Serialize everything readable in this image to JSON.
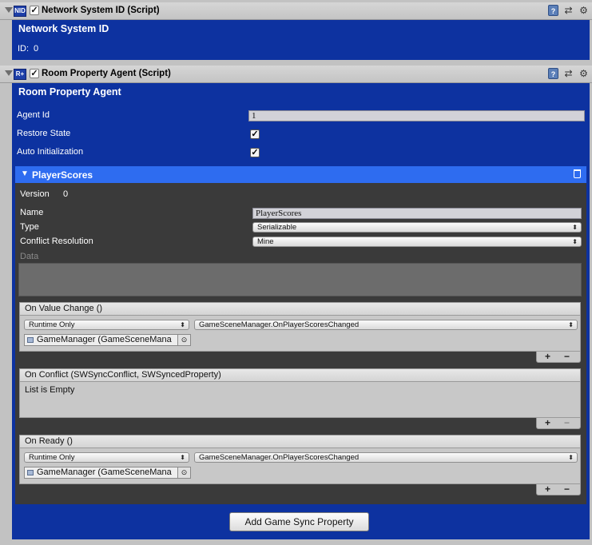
{
  "components": [
    {
      "title": "Network System ID (Script)",
      "icon_text": "NID",
      "enabled": true
    },
    {
      "title": "Room Property Agent (Script)",
      "icon_text": "R+",
      "enabled": true
    }
  ],
  "network_id": {
    "heading": "Network System ID",
    "id_label": "ID:",
    "id_value": "0"
  },
  "room_agent": {
    "heading": "Room Property Agent",
    "agent_id_label": "Agent Id",
    "agent_id_value": "1",
    "restore_state_label": "Restore State",
    "restore_state": true,
    "auto_init_label": "Auto Initialization",
    "auto_init": true
  },
  "property": {
    "header": "PlayerScores",
    "version_label": "Version",
    "version_value": "0",
    "name_label": "Name",
    "name_value": "PlayerScores",
    "type_label": "Type",
    "type_value": "Serializable",
    "conflict_label": "Conflict Resolution",
    "conflict_value": "Mine",
    "data_label": "Data"
  },
  "events": {
    "value_change": {
      "title": "On Value Change ()",
      "runtime": "Runtime Only",
      "method": "GameSceneManager.OnPlayerScoresChanged",
      "object": "GameManager (GameSceneMana"
    },
    "conflict": {
      "title": "On Conflict (SWSyncConflict, SWSyncedProperty)",
      "empty_text": "List is Empty"
    },
    "ready": {
      "title": "On Ready ()",
      "runtime": "Runtime Only",
      "method": "GameSceneManager.OnPlayerScoresChanged",
      "object": "GameManager (GameSceneMana"
    }
  },
  "add_button": "Add Game Sync Property",
  "icons": {
    "help": "help-icon",
    "preset": "preset-icon",
    "settings": "gear-icon",
    "trash": "trash-icon"
  },
  "colors": {
    "panel_blue": "#0d32a0",
    "header_blue": "#2e6cf0",
    "dark_area": "#3a3a3a"
  }
}
